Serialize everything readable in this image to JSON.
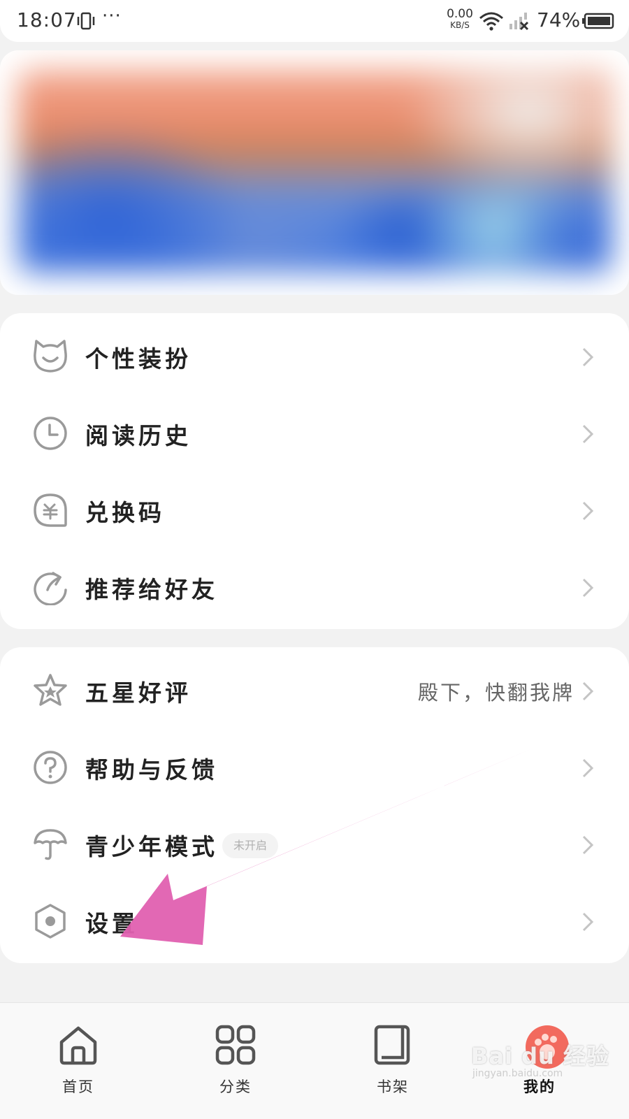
{
  "status_bar": {
    "time": "18:07",
    "more": "···",
    "net_speed": "0.00",
    "net_unit": "KB/S",
    "battery": "74%"
  },
  "menu_group_1": [
    {
      "label": "个性装扮",
      "icon": "cat-face-icon"
    },
    {
      "label": "阅读历史",
      "icon": "clock-icon"
    },
    {
      "label": "兑换码",
      "icon": "redeem-code-icon"
    },
    {
      "label": "推荐给好友",
      "icon": "share-arrow-icon"
    }
  ],
  "menu_group_2": [
    {
      "label": "五星好评",
      "icon": "star-icon",
      "right_text": "殿下，快翻我牌"
    },
    {
      "label": "帮助与反馈",
      "icon": "help-circle-icon"
    },
    {
      "label": "青少年模式",
      "icon": "umbrella-icon",
      "badge": "未开启"
    },
    {
      "label": "设置",
      "icon": "settings-hexagon-icon"
    }
  ],
  "bottom_nav": [
    {
      "label": "首页",
      "icon": "home-icon",
      "active": false
    },
    {
      "label": "分类",
      "icon": "category-grid-icon",
      "active": false
    },
    {
      "label": "书架",
      "icon": "bookshelf-icon",
      "active": false
    },
    {
      "label": "我的",
      "icon": "profile-paw-icon",
      "active": true
    }
  ],
  "watermark": {
    "text": "Bai du 经验",
    "sub": "jingyan.baidu.com"
  },
  "colors": {
    "accent_active": "#f26a5e",
    "annotation_arrow": "#e060b0",
    "page_bg": "#f2f2f2",
    "card_bg": "#ffffff",
    "icon_gray": "#9a9a9a"
  }
}
